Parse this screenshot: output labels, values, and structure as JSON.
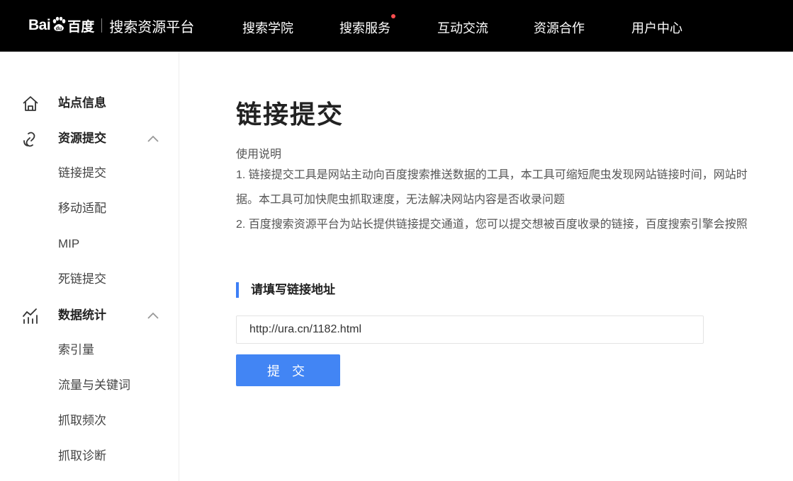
{
  "header": {
    "logo_text": "Bai",
    "logo_badge": "du",
    "logo_cn": "百度",
    "platform": "搜索资源平台",
    "nav": [
      {
        "label": "搜索学院"
      },
      {
        "label": "搜索服务",
        "has_dot": true
      },
      {
        "label": "互动交流"
      },
      {
        "label": "资源合作"
      },
      {
        "label": "用户中心"
      }
    ]
  },
  "sidebar": {
    "groups": [
      {
        "label": "站点信息",
        "icon": "home-icon",
        "items": []
      },
      {
        "label": "资源提交",
        "icon": "link-submit-icon",
        "expanded": true,
        "items": [
          "链接提交",
          "移动适配",
          "MIP",
          "死链提交"
        ]
      },
      {
        "label": "数据统计",
        "icon": "stats-icon",
        "expanded": true,
        "items": [
          "索引量",
          "流量与关键词",
          "抓取频次",
          "抓取诊断"
        ]
      }
    ]
  },
  "main": {
    "title": "链接提交",
    "usage_heading": "使用说明",
    "usage_lines": [
      "1. 链接提交工具是网站主动向百度搜索推送数据的工具，本工具可缩短爬虫发现网站链接时间，网站时",
      "据。本工具可加快爬虫抓取速度，无法解决网站内容是否收录问题",
      "2. 百度搜索资源平台为站长提供链接提交通道，您可以提交想被百度收录的链接，百度搜索引擎会按照"
    ],
    "section_title": "请填写链接地址",
    "url_value": "http://ura.cn/1182.html",
    "submit_label": "提 交"
  },
  "colors": {
    "header_bg": "#000000",
    "accent": "#4285f4",
    "section_bar": "#3d7ff6",
    "nav_dot": "#ff4d4f"
  }
}
